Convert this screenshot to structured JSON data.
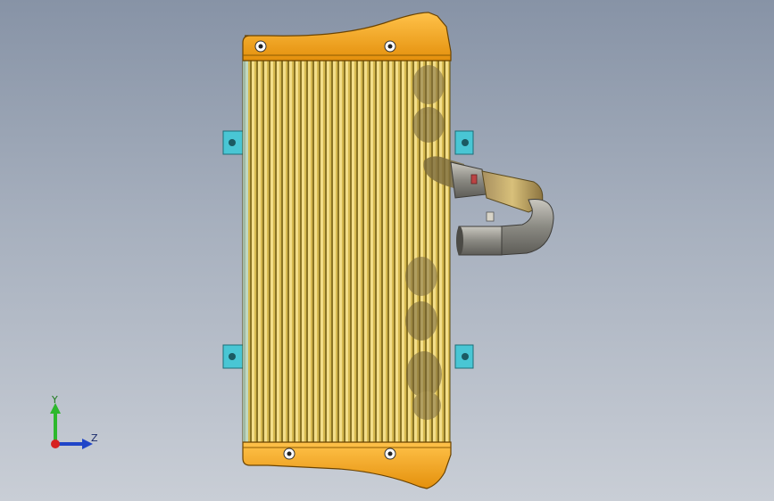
{
  "viewport": {
    "background_top": "#8793a6",
    "background_bottom": "#c9ced6"
  },
  "model": {
    "part": "intercooler-assembly",
    "tank_color": "#f5a61c",
    "core_color": "#e8c24a",
    "bracket_color": "#49c6d4",
    "pipe_color": "#8e8e8a"
  },
  "triad": {
    "y_label": "Y",
    "z_label": "Z",
    "y_color": "#2db82d",
    "z_color": "#2045c8",
    "x_color": "#d62020"
  }
}
